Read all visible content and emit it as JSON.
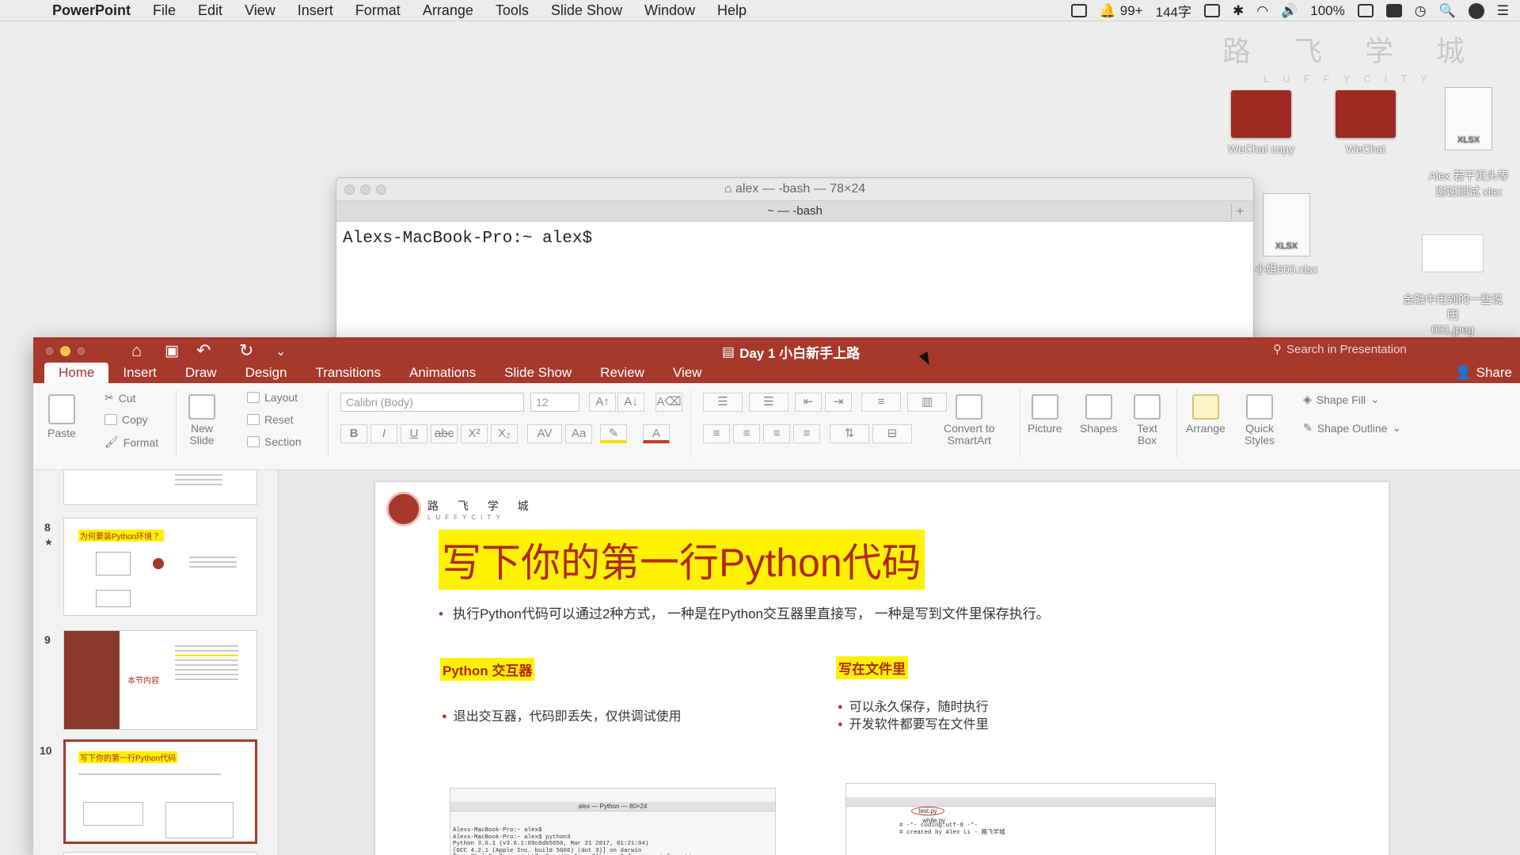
{
  "menubar": {
    "app": "PowerPoint",
    "items": [
      "File",
      "Edit",
      "View",
      "Insert",
      "Format",
      "Arrange",
      "Tools",
      "Slide Show",
      "Window",
      "Help"
    ],
    "badge": "99+",
    "wordcount": "144字",
    "battery": "100%"
  },
  "desktop": {
    "watermark_cn": "路 飞 学 城",
    "watermark_en": "LUFFYCITY",
    "icons": [
      {
        "label": "WeChat copy"
      },
      {
        "label": "WeChat"
      },
      {
        "label": "Alex 若干页头等\n谢谢测试 xlsx",
        "doc_tag": "XLSX"
      },
      {
        "label": "小姐600.xlsx",
        "doc_tag": "XLSX"
      },
      {
        "label": "金融中用到的一些说明\n001.jpeg"
      }
    ]
  },
  "terminal": {
    "title": "alex — -bash — 78×24",
    "tab": "~ — -bash",
    "prompt": "Alexs-MacBook-Pro:~ alex$"
  },
  "ppt": {
    "doc_title": "Day 1 小白新手上路",
    "search_placeholder": "Search in Presentation",
    "share": "Share",
    "tabs": [
      "Home",
      "Insert",
      "Draw",
      "Design",
      "Transitions",
      "Animations",
      "Slide Show",
      "Review",
      "View"
    ],
    "ribbon": {
      "paste": "Paste",
      "cut": "Cut",
      "copy": "Copy",
      "format": "Format",
      "new_slide": "New\nSlide",
      "layout": "Layout",
      "reset": "Reset",
      "section": "Section",
      "font": "Calibri (Body)",
      "size": "12",
      "smartart": "Convert to\nSmartArt",
      "picture": "Picture",
      "shapes": "Shapes",
      "textbox": "Text\nBox",
      "arrange": "Arrange",
      "quick_styles": "Quick\nStyles",
      "shape_fill": "Shape Fill",
      "shape_outline": "Shape Outline"
    },
    "thumbs": [
      {
        "num": "8",
        "title": "为何要装Python环境 ？"
      },
      {
        "num": "9",
        "title": "本节内容"
      },
      {
        "num": "10",
        "title": "写下你的第一行Python代码"
      }
    ],
    "slide": {
      "logo_cn": "路 飞 学 城",
      "logo_en": "LUFFYCITY",
      "title": "写下你的第一行Python代码",
      "bullet": "执行Python代码可以通过2种方式， 一种是在Python交互器里直接写， 一种是写到文件里保存执行。",
      "left_label": "Python 交互器",
      "left_bullet": "退出交互器，代码即丢失，仅供调试使用",
      "right_label": "写在文件里",
      "right_bullets": [
        "可以永久保存，随时执行",
        "开发软件都要写在文件里"
      ],
      "term_shot_title": "alex — Python — 80×24",
      "term_shot_text": "Alexs-MacBook-Pro:~ alex$\nAlexs-MacBook-Pro:~ alex$ python3\nPython 3.6.1 (v3.6.1:69c0db5050, Mar 21 2017, 01:21:04)\n[GCC 4.2.1 (Apple Inc. build 5666) (dot 3)] on darwin\nType \"help\", \"copyright\", \"credits\" or \"license\" for more information.\n>>> print(\"hello world\")\nhello world",
      "editor_tab1": "test.py",
      "editor_tab2": "while.py",
      "editor_text": "  # -*- coding:utf-8 -*-\n  # created by Alex Li - 路飞学城\n\n\n\n  print(\"Hello World.\")\n  print(\"Hello World.\")\n  print(\"Hello World.\")"
    }
  }
}
